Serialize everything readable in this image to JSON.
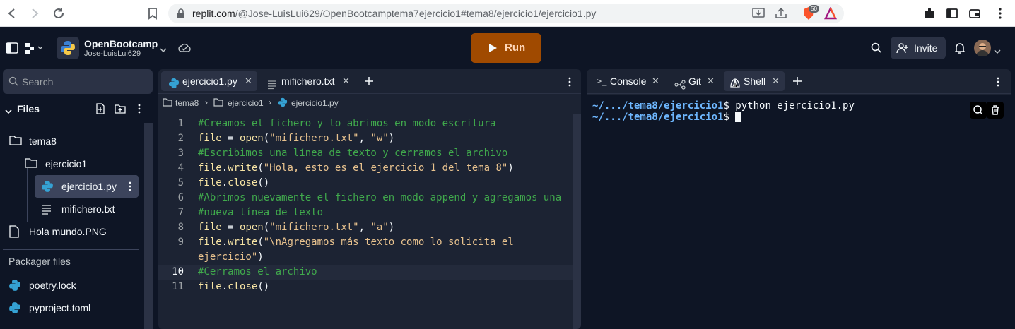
{
  "browser": {
    "url_domain": "replit.com",
    "url_path": "/@Jose-LuisLui629/OpenBootcamptema7ejercicio1#tema8/ejercicio1/ejercicio1.py",
    "shield_badge": "50"
  },
  "header": {
    "repl_name": "OpenBootcamp",
    "owner": "Jose-LuisLui629",
    "run_label": "Run",
    "invite_label": "Invite"
  },
  "sidebar": {
    "search_placeholder": "Search",
    "files_title": "Files",
    "tree": [
      {
        "label": "tema8"
      },
      {
        "label": "ejercicio1"
      },
      {
        "label": "ejercicio1.py"
      },
      {
        "label": "mifichero.txt"
      },
      {
        "label": "Hola mundo.PNG"
      }
    ],
    "packager_title": "Packager files",
    "packager": [
      {
        "label": "poetry.lock"
      },
      {
        "label": "pyproject.toml"
      }
    ]
  },
  "editor": {
    "tabs": [
      {
        "label": "ejercicio1.py"
      },
      {
        "label": "mifichero.txt"
      }
    ],
    "breadcrumb": [
      "tema8",
      "ejercicio1",
      "ejercicio1.py"
    ],
    "lines": [
      "1",
      "2",
      "3",
      "4",
      "5",
      "6",
      "7",
      "8",
      "9",
      "",
      "10",
      "11"
    ]
  },
  "right": {
    "tabs": [
      {
        "label": "Console"
      },
      {
        "label": "Git"
      },
      {
        "label": "Shell"
      }
    ],
    "prompt_path": "~/.../tema8/ejercicio1",
    "prompt_suffix": "$ ",
    "command": "python ejercicio1.py"
  },
  "colors": {
    "accent": "#0079f2",
    "run_bg": "#a04a00",
    "comment": "#40a94c",
    "string": "#e8c28e",
    "bg": "#0e1525",
    "panel": "#1c2333"
  }
}
